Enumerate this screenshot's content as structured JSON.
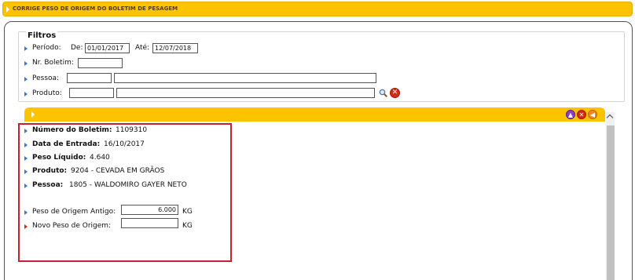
{
  "window": {
    "title": "CORRIGE PESO DE ORIGEM DO BOLETIM DE PESAGEM"
  },
  "filters": {
    "legend": "Filtros",
    "periodo_label": "Período:",
    "de_label": "De:",
    "de_value": "01/01/2017",
    "ate_label": "Até:",
    "ate_value": "12/07/2018",
    "boletim_label": "Nr. Boletim:",
    "boletim_value": "",
    "pessoa_label": "Pessoa:",
    "pessoa_code": "",
    "pessoa_name": "",
    "produto_label": "Produto:",
    "produto_code": "",
    "produto_mid": "",
    "produto_name": ""
  },
  "icons": {
    "search": "search-icon",
    "clear": "clear-icon",
    "up": "up-icon",
    "close": "close-icon",
    "back": "back-icon"
  },
  "details": {
    "boletim_label": "Número do Boletim:",
    "boletim_value": "1109310",
    "entrada_label": "Data de Entrada:",
    "entrada_value": "16/10/2017",
    "peso_liquido_label": "Peso Líquido:",
    "peso_liquido_value": "4.640",
    "produto_label": "Produto:",
    "produto_value": "9204 - CEVADA EM GRÃOS",
    "pessoa_label": "Pessoa:",
    "pessoa_value": "1805 - WALDOMIRO GAYER NETO",
    "peso_antigo_label": "Peso de Origem Antigo:",
    "peso_antigo_value": "6.000",
    "peso_antigo_unit": "KG",
    "novo_peso_label": "Novo Peso de Origem:",
    "novo_peso_value": "",
    "novo_peso_unit": "KG"
  },
  "colors": {
    "header_bar": "#fcc400",
    "highlight_border": "#c82030",
    "bullet": "#3a78c4",
    "bullet_required": "#d22a1a"
  }
}
